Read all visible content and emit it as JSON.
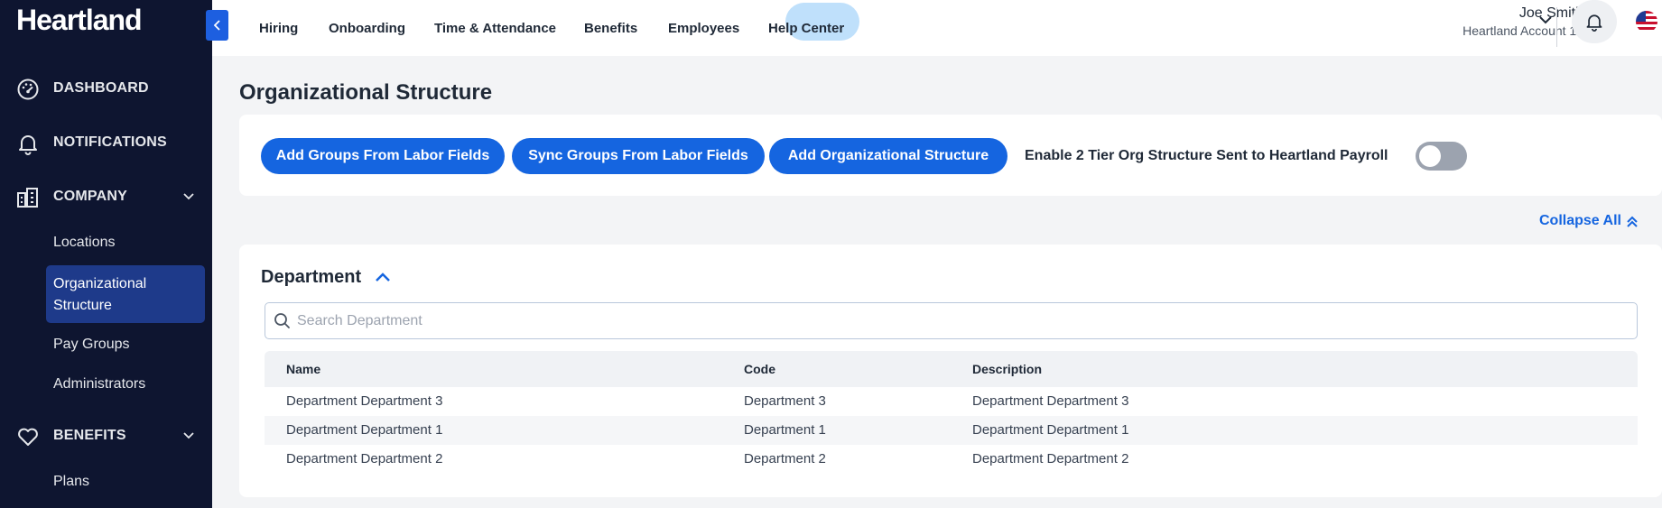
{
  "sidebar": {
    "logo": "Heartland",
    "items": [
      {
        "label": "DASHBOARD"
      },
      {
        "label": "NOTIFICATIONS"
      },
      {
        "label": "COMPANY"
      },
      {
        "label": "BENEFITS"
      }
    ],
    "company_sub": [
      "Locations",
      "Organizational Structure",
      "Pay Groups",
      "Administrators"
    ],
    "benefits_sub": [
      "Plans"
    ]
  },
  "topnav": {
    "tabs": [
      "Hiring",
      "Onboarding",
      "Time & Attendance",
      "Benefits",
      "Employees",
      "Help Center"
    ],
    "active_tab": "Benefits"
  },
  "user": {
    "name": "Joe Smith",
    "account": "Heartland Account 10"
  },
  "page": {
    "title": "Organizational Structure",
    "buttons": {
      "add_groups": "Add Groups From Labor Fields",
      "sync_groups": "Sync Groups From Labor Fields",
      "add_structure": "Add Organizational Structure"
    },
    "enable_label": "Enable 2 Tier Org Structure Sent to Heartland Payroll",
    "toggle_on": false,
    "collapse_all": "Collapse All"
  },
  "department": {
    "title": "Department",
    "search_placeholder": "Search Department",
    "search_value": "",
    "columns": [
      "Name",
      "Code",
      "Description"
    ],
    "rows": [
      [
        "Department Department 3",
        "Department 3",
        "Department Department 3"
      ],
      [
        "Department Department 1",
        "Department 1",
        "Department Department 1"
      ],
      [
        "Department Department 2",
        "Department 2",
        "Department Department 2"
      ]
    ]
  },
  "colors": {
    "sidebar_bg": "#0e1530",
    "sidebar_active": "#1e3a8a",
    "primary": "#1565e0",
    "active_tab_bg": "#bfe0fb"
  },
  "icons": {
    "dashboard": "gauge-icon",
    "notifications": "bell-icon",
    "company": "building-icon",
    "benefits": "heart-icon"
  }
}
